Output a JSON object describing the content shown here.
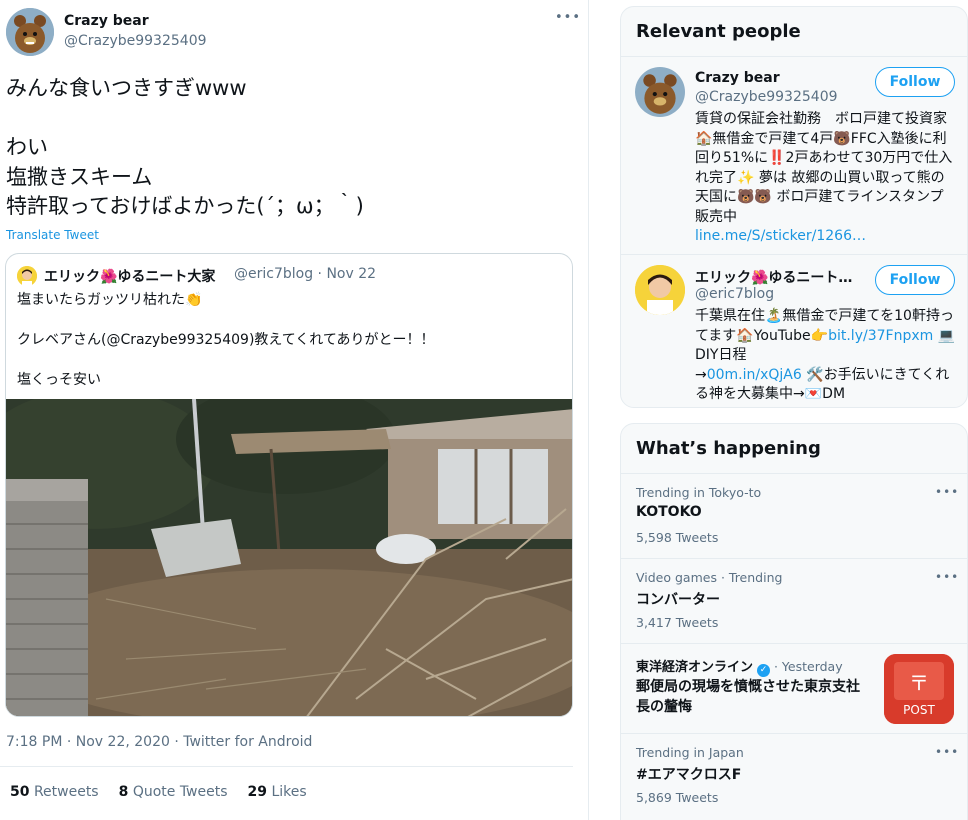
{
  "tweet": {
    "author_name": "Crazy bear",
    "author_handle": "@Crazybe99325409",
    "more_icon": "more-icon",
    "text": "みんな食いつきすぎwww\n\nわい\n塩撒きスキーム\n特許取っておけばよかった(´；ω；｀)",
    "translate_label": "Translate Tweet",
    "timestamp": "7:18 PM · Nov 22, 2020 · Twitter for Android",
    "stats": {
      "retweets_count": "50",
      "retweets_label": "Retweets",
      "quotes_count": "8",
      "quotes_label": "Quote Tweets",
      "likes_count": "29",
      "likes_label": "Likes"
    }
  },
  "quote": {
    "author_name": "エリック🌺ゆるニート大家",
    "author_handle": "@eric7blog · Nov 22",
    "text": "塩まいたらガッツリ枯れた👏\n\nクレベアさん(@Crazybe99325409)教えてくれてありがとー！！\n\n塩くっそ安い"
  },
  "relevant_people": {
    "title": "Relevant people",
    "people": [
      {
        "name": "Crazy bear",
        "handle": "@Crazybe99325409",
        "follow_label": "Follow",
        "bio": "賃貸の保証会社勤務　ボロ戸建て投資家🏠無借金で戸建て4戸🐻FFC入塾後に利回り51%に‼️2戸あわせて30万円で仕入れ完了✨ 夢は 故郷の山買い取って熊の天国に🐻🐻 ボロ戸建てラインスタンプ販売中",
        "link": "line.me/S/sticker/1266…"
      },
      {
        "name": "エリック🌺ゆるニート…",
        "handle": "@eric7blog",
        "follow_label": "Follow",
        "bio_1": "千葉県在住🏝️無借金で戸建てを10軒持ってます🏠YouTube👉",
        "link_1": "bit.ly/37Fnpxm",
        "bio_2": " 💻DIY日程\n→",
        "link_2": "00m.in/xQjA6",
        "bio_3": " 🛠️お手伝いにきてくれる神を大募集中→💌DM"
      }
    ]
  },
  "whats_happening": {
    "title": "What’s happening",
    "trends": [
      {
        "meta": "Trending in Tokyo-to",
        "name": "KOTOKO",
        "count": "5,598 Tweets"
      },
      {
        "meta": "Video games · Trending",
        "name": "コンバーター",
        "count": "3,417 Tweets"
      }
    ],
    "news": {
      "source": "東洋経済オンライン",
      "time": "· Yesterday",
      "title": "郵便局の現場を憤慨させた東京支社長の釐悔",
      "thumb_text": "POST"
    },
    "trend_last": {
      "meta": "Trending in Japan",
      "name": "#エアマクロスF",
      "count": "5,869 Tweets"
    }
  },
  "colors": {
    "accent": "#1da1f2",
    "link": "#1b95e0",
    "muted": "#5b7083"
  }
}
